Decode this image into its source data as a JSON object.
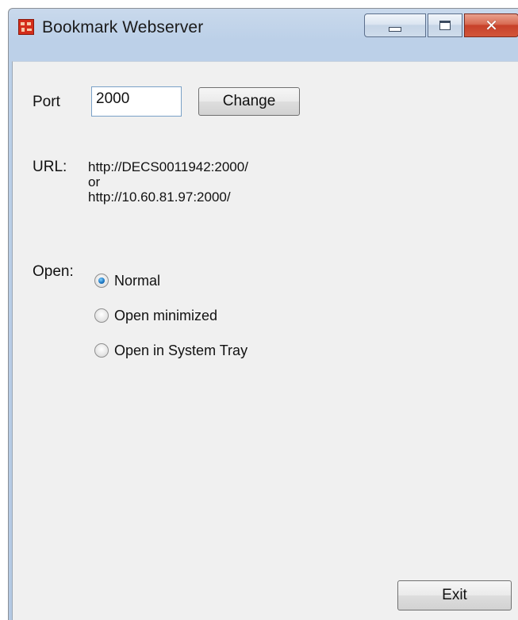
{
  "window": {
    "title": "Bookmark Webserver"
  },
  "port": {
    "label": "Port",
    "value": "2000",
    "change_button": "Change"
  },
  "url": {
    "label": "URL:",
    "primary": "http://DECS0011942:2000/",
    "separator": "or",
    "secondary": "http://10.60.81.97:2000/"
  },
  "open": {
    "label": "Open:",
    "options": [
      {
        "label": "Normal",
        "checked": true
      },
      {
        "label": "Open minimized",
        "checked": false
      },
      {
        "label": "Open in System Tray",
        "checked": false
      }
    ]
  },
  "footer": {
    "exit_button": "Exit"
  },
  "icons": {
    "app": "bookmark-app-icon",
    "minimize": "minimize-icon",
    "maximize": "maximize-icon",
    "close": "close-icon"
  },
  "colors": {
    "titlebar": "#bcd0e8",
    "client_bg": "#f0f0f0",
    "close_button": "#c7412a",
    "radio_checked": "#1f78c4"
  }
}
